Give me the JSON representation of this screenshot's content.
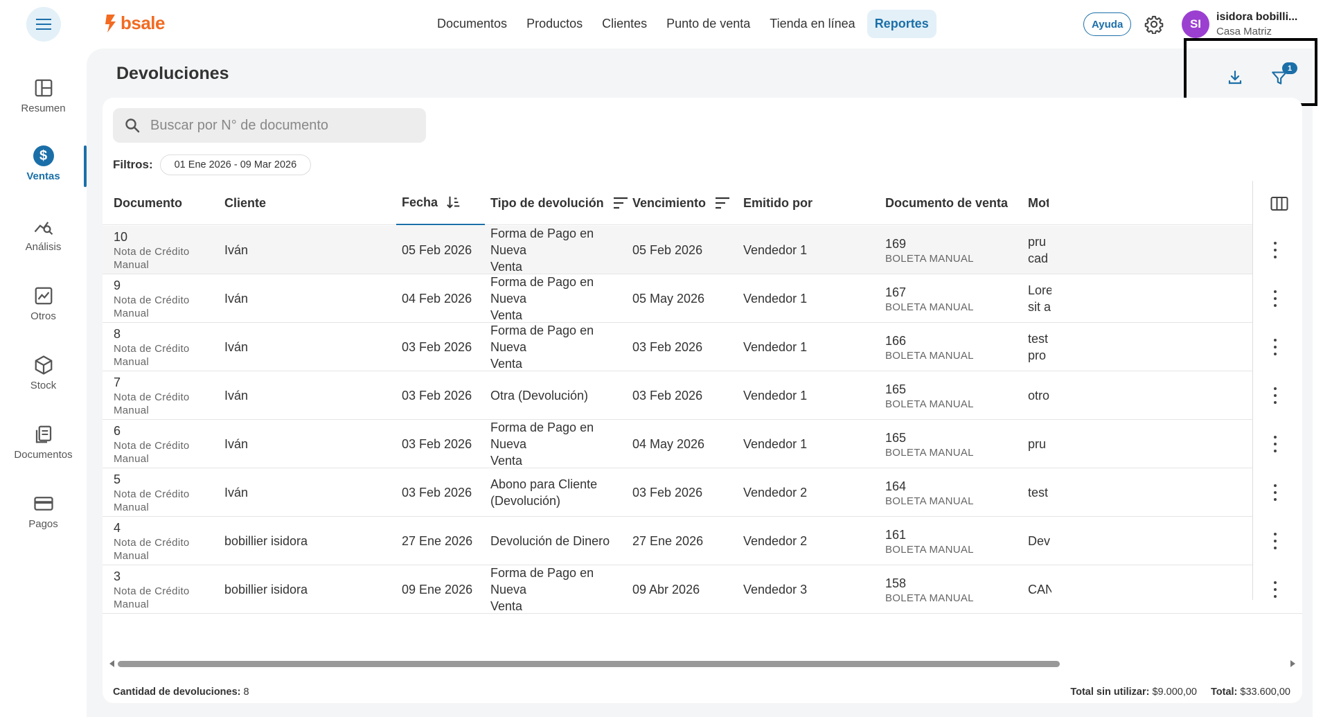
{
  "brand": {
    "name": "bsale",
    "color": "#f26b21"
  },
  "accent": "#1b6fa8",
  "nav": [
    {
      "label": "Documentos",
      "active": false
    },
    {
      "label": "Productos",
      "active": false
    },
    {
      "label": "Clientes",
      "active": false
    },
    {
      "label": "Punto de venta",
      "active": false
    },
    {
      "label": "Tienda en línea",
      "active": false
    },
    {
      "label": "Reportes",
      "active": true
    }
  ],
  "header": {
    "help_label": "Ayuda",
    "user_initials": "SI",
    "user_name": "isidora bobilli...",
    "user_branch": "Casa Matriz"
  },
  "sidebar": {
    "items": [
      {
        "label": "Resumen",
        "icon": "layout-icon"
      },
      {
        "label": "Ventas",
        "icon": "dollar-icon",
        "active": true
      },
      {
        "label": "Análisis",
        "icon": "analytics-icon"
      },
      {
        "label": "Otros",
        "icon": "chart-icon"
      },
      {
        "label": "Stock",
        "icon": "box-icon"
      },
      {
        "label": "Documentos",
        "icon": "documents-icon"
      },
      {
        "label": "Pagos",
        "icon": "card-icon"
      }
    ]
  },
  "page": {
    "title": "Devoluciones",
    "filter_badge": "1",
    "search_placeholder": "Buscar por N° de documento",
    "filters_label": "Filtros:",
    "date_chip": "01 Ene 2026 - 09 Mar 2026"
  },
  "table": {
    "columns": {
      "documento": "Documento",
      "cliente": "Cliente",
      "fecha": "Fecha",
      "tipo": "Tipo de devolución",
      "vencimiento": "Vencimiento",
      "emitido": "Emitido por",
      "doc_venta": "Documento de venta",
      "motivo": "Mot"
    },
    "rows": [
      {
        "num": "10",
        "doc_type": "Nota de Crédito Manual",
        "cliente": "Iván",
        "fecha": "05 Feb 2026",
        "tipo1": "Forma de Pago en Nueva",
        "tipo2": "Venta",
        "venc": "05 Feb 2026",
        "emitido": "Vendedor 1",
        "venta_num": "169",
        "venta_type": "BOLETA MANUAL",
        "mot1": "pru",
        "mot2": "cad"
      },
      {
        "num": "9",
        "doc_type": "Nota de Crédito Manual",
        "cliente": "Iván",
        "fecha": "04 Feb 2026",
        "tipo1": "Forma de Pago en Nueva",
        "tipo2": "Venta",
        "venc": "05 May 2026",
        "emitido": "Vendedor 1",
        "venta_num": "167",
        "venta_type": "BOLETA MANUAL",
        "mot1": "Lore",
        "mot2": "sit a"
      },
      {
        "num": "8",
        "doc_type": "Nota de Crédito Manual",
        "cliente": "Iván",
        "fecha": "03 Feb 2026",
        "tipo1": "Forma de Pago en Nueva",
        "tipo2": "Venta",
        "venc": "03 Feb 2026",
        "emitido": "Vendedor 1",
        "venta_num": "166",
        "venta_type": "BOLETA MANUAL",
        "mot1": "test",
        "mot2": "pro"
      },
      {
        "num": "7",
        "doc_type": "Nota de Crédito Manual",
        "cliente": "Iván",
        "fecha": "03 Feb 2026",
        "tipo1": "Otra (Devolución)",
        "tipo2": "",
        "venc": "03 Feb 2026",
        "emitido": "Vendedor 1",
        "venta_num": "165",
        "venta_type": "BOLETA MANUAL",
        "mot1": "otro",
        "mot2": ""
      },
      {
        "num": "6",
        "doc_type": "Nota de Crédito Manual",
        "cliente": "Iván",
        "fecha": "03 Feb 2026",
        "tipo1": "Forma de Pago en Nueva",
        "tipo2": "Venta",
        "venc": "04 May 2026",
        "emitido": "Vendedor 1",
        "venta_num": "165",
        "venta_type": "BOLETA MANUAL",
        "mot1": "pru",
        "mot2": ""
      },
      {
        "num": "5",
        "doc_type": "Nota de Crédito Manual",
        "cliente": "Iván",
        "fecha": "03 Feb 2026",
        "tipo1": "Abono para Cliente",
        "tipo2": "(Devolución)",
        "venc": "03 Feb 2026",
        "emitido": "Vendedor 2",
        "venta_num": "164",
        "venta_type": "BOLETA MANUAL",
        "mot1": "test",
        "mot2": ""
      },
      {
        "num": "4",
        "doc_type": "Nota de Crédito Manual",
        "cliente": "bobillier isidora",
        "fecha": "27 Ene 2026",
        "tipo1": "Devolución de Dinero",
        "tipo2": "",
        "venc": "27 Ene 2026",
        "emitido": "Vendedor 2",
        "venta_num": "161",
        "venta_type": "BOLETA MANUAL",
        "mot1": "Dev",
        "mot2": ""
      },
      {
        "num": "3",
        "doc_type": "Nota de Crédito Manual",
        "cliente": "bobillier isidora",
        "fecha": "09 Ene 2026",
        "tipo1": "Forma de Pago en Nueva",
        "tipo2": "Venta",
        "venc": "09 Abr 2026",
        "emitido": "Vendedor 3",
        "venta_num": "158",
        "venta_type": "BOLETA MANUAL",
        "mot1": "CAN",
        "mot2": ""
      }
    ]
  },
  "footer": {
    "count_label": "Cantidad de devoluciones:",
    "count_value": "8",
    "unused_label": "Total sin utilizar:",
    "unused_value": "$9.000,00",
    "total_label": "Total:",
    "total_value": "$33.600,00"
  }
}
